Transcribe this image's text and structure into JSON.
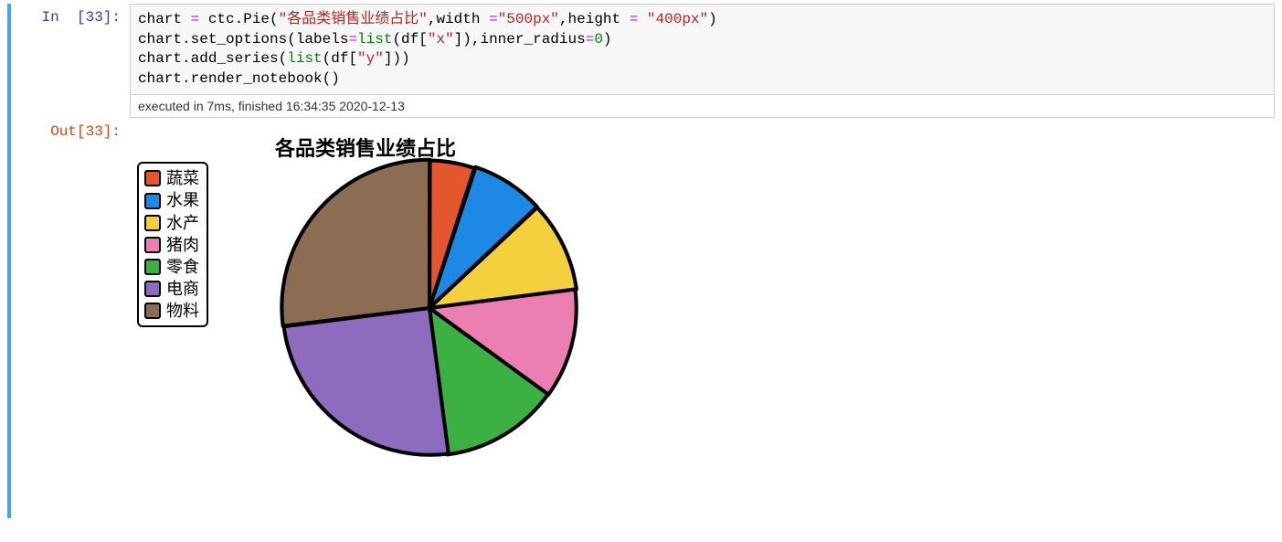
{
  "cell": {
    "in_prompt": "In  [33]:",
    "out_prompt": "Out[33]:",
    "exec_status": "executed in 7ms, finished 16:34:35 2020-12-13"
  },
  "code": {
    "line1_pre": "chart ",
    "line1_op": "=",
    "line1_mid1": " ctc.Pie(",
    "line1_str1": "\"各品类销售业绩占比\"",
    "line1_mid2": ",width ",
    "line1_op2": "=",
    "line1_str2": "\"500px\"",
    "line1_mid3": ",height ",
    "line1_op3": "= ",
    "line1_str3": "\"400px\"",
    "line1_end": ")",
    "line2_a": "chart.set_options(labels",
    "line2_op1": "=",
    "line2_b": "list",
    "line2_c": "(df[",
    "line2_str1": "\"x\"",
    "line2_d": "]),inner_radius",
    "line2_op2": "=",
    "line2_num": "0",
    "line2_e": ")",
    "line3_a": "chart.add_series(",
    "line3_b": "list",
    "line3_c": "(df[",
    "line3_str": "\"y\"",
    "line3_d": "]))",
    "line4": "chart.render_notebook()"
  },
  "chart_data": {
    "type": "pie",
    "title": "各品类销售业绩占比",
    "series": [
      {
        "name": "蔬菜",
        "value": 5,
        "color": "#e4572e"
      },
      {
        "name": "水果",
        "value": 8,
        "color": "#1e88e5"
      },
      {
        "name": "水产",
        "value": 10,
        "color": "#f4d03f"
      },
      {
        "name": "猪肉",
        "value": 12,
        "color": "#ec7fb1"
      },
      {
        "name": "零食",
        "value": 13,
        "color": "#3cb043"
      },
      {
        "name": "电商",
        "value": 25,
        "color": "#8e6bbf"
      },
      {
        "name": "物料",
        "value": 27,
        "color": "#8c6d54"
      }
    ]
  }
}
